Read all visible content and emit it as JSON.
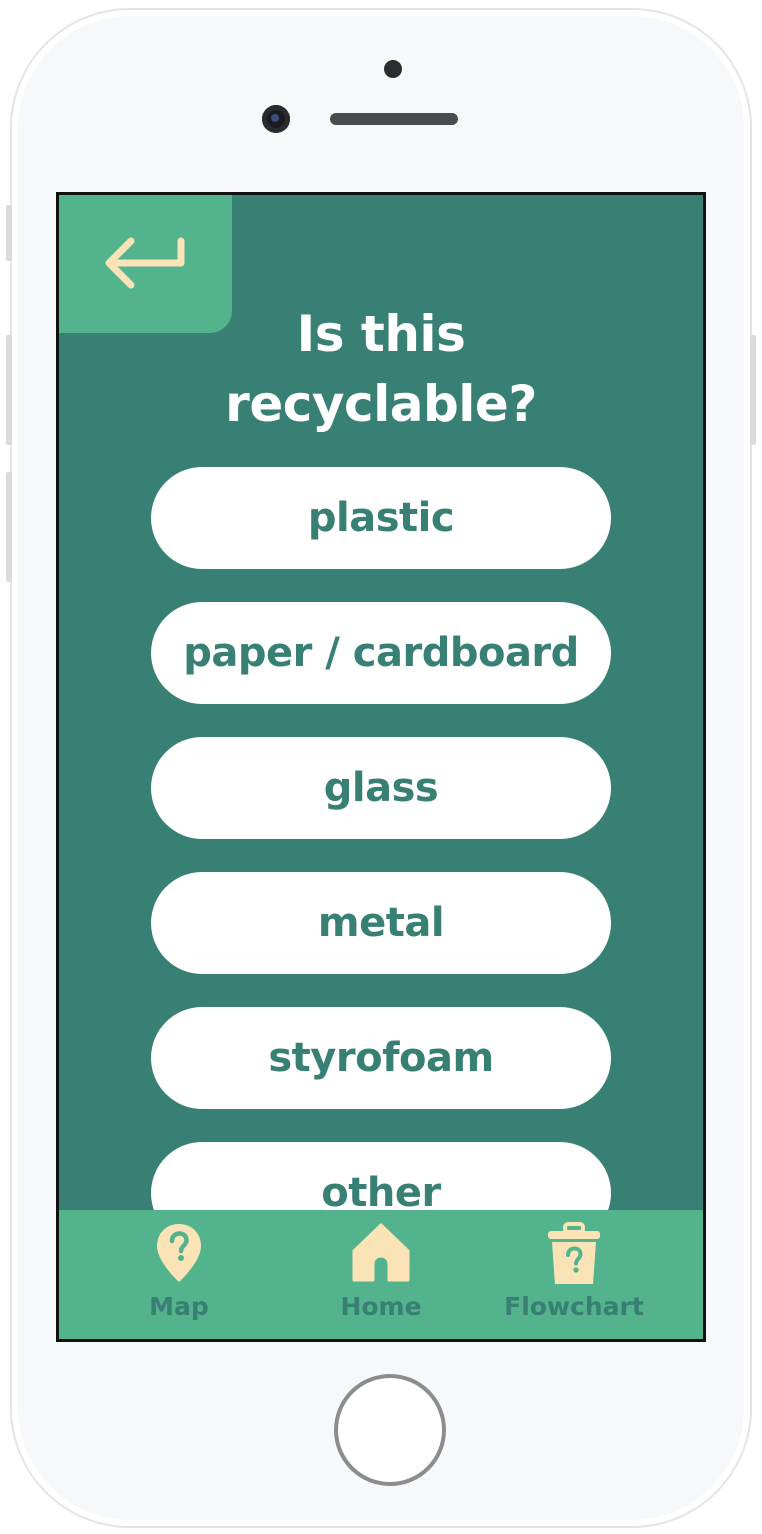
{
  "colors": {
    "screen_bg": "#387f74",
    "accent_green": "#53b38c",
    "cream_icon": "#fbe3b8",
    "button_bg": "#ffffff",
    "button_text": "#387f74"
  },
  "header": {
    "back_icon": "return-arrow-icon",
    "title_line1": "Is this",
    "title_line2": "recyclable?"
  },
  "options": [
    {
      "label": "plastic"
    },
    {
      "label": "paper / cardboard"
    },
    {
      "label": "glass"
    },
    {
      "label": "metal"
    },
    {
      "label": "styrofoam"
    },
    {
      "label": "other"
    }
  ],
  "tabbar": {
    "tabs": [
      {
        "label": "Map",
        "icon": "map-pin-question-icon"
      },
      {
        "label": "Home",
        "icon": "house-icon"
      },
      {
        "label": "Flowchart",
        "icon": "trash-question-icon"
      }
    ]
  }
}
